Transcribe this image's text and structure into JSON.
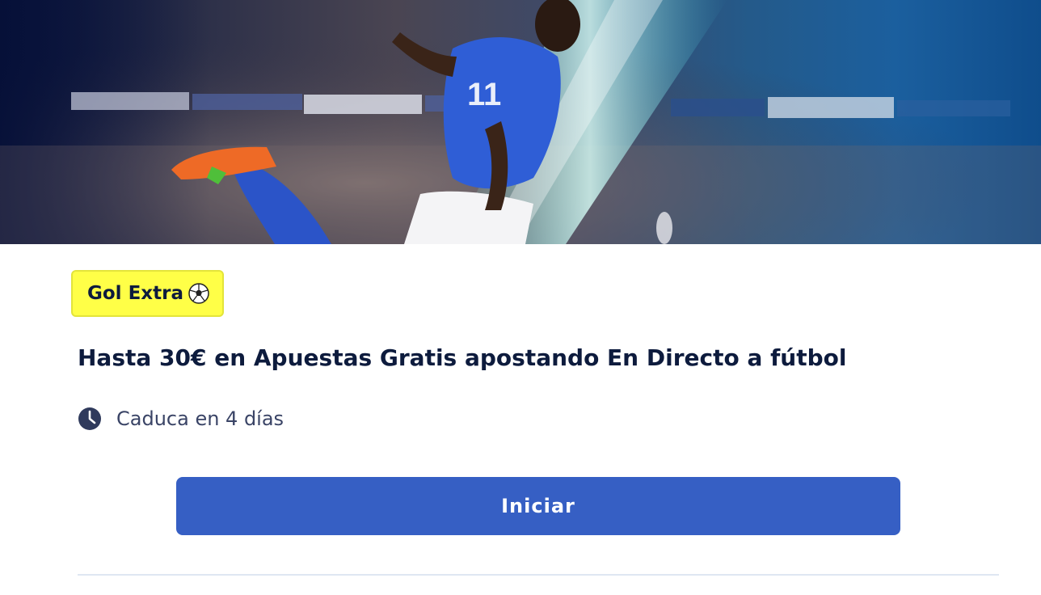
{
  "promo": {
    "badge_label": "Gol Extra",
    "badge_icon": "soccer-ball-icon",
    "title": "Hasta 30€ en Apuestas Gratis apostando En Directo a fútbol",
    "expiry_icon": "clock-icon",
    "expiry_text": "Caduca en 4 días",
    "cta_label": "Iniciar"
  },
  "colors": {
    "badge_background": "#ffff47",
    "title_text": "#0d1b3d",
    "cta_background": "#365fc4",
    "cta_text": "#ffffff",
    "divider": "#dfe7f2"
  }
}
